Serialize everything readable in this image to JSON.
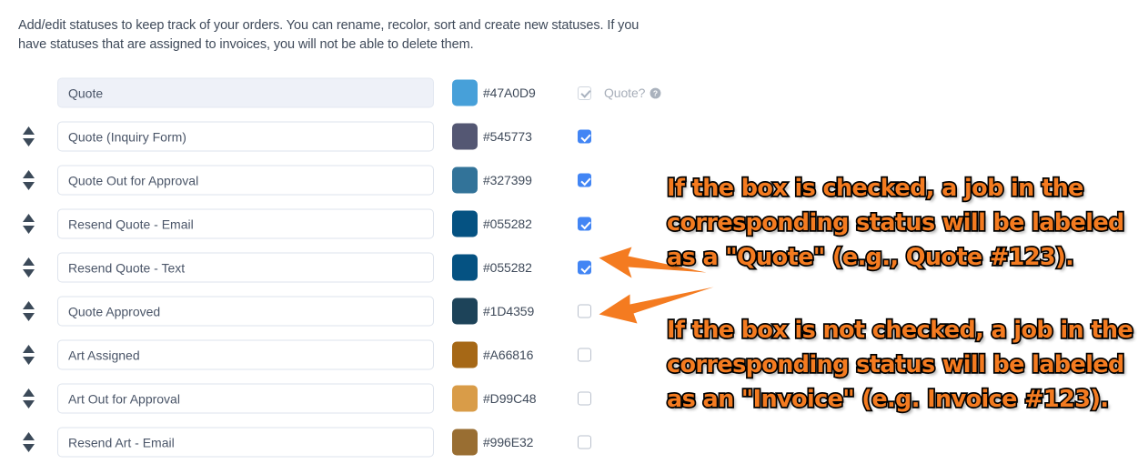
{
  "intro": {
    "text": "Add/edit statuses to keep track of your orders. You can rename, recolor, sort and create new statuses. If you have statuses that are assigned to invoices, you will not be able to delete them."
  },
  "quote_column": {
    "label": "Quote?",
    "help_icon": "help-circle-icon"
  },
  "icons": {
    "sort": "sort-updown-icon",
    "swatch": "color-swatch-icon",
    "arrow": "arrow-left-icon"
  },
  "colors": {
    "checkbox_checked": "#4285f4",
    "annotation": "#F47B20",
    "annotation_outline": "#000000",
    "arrow": "#F47B20"
  },
  "rows": [
    {
      "name": "Quote",
      "hex": "#47A0D9",
      "checked": true,
      "disabled": true,
      "sortable": false,
      "show_quote_label": true
    },
    {
      "name": "Quote (Inquiry Form)",
      "hex": "#545773",
      "checked": true,
      "disabled": false,
      "sortable": true,
      "show_quote_label": false
    },
    {
      "name": "Quote Out for Approval",
      "hex": "#327399",
      "checked": true,
      "disabled": false,
      "sortable": true,
      "show_quote_label": false
    },
    {
      "name": "Resend Quote - Email",
      "hex": "#055282",
      "checked": true,
      "disabled": false,
      "sortable": true,
      "show_quote_label": false
    },
    {
      "name": "Resend Quote - Text",
      "hex": "#055282",
      "checked": true,
      "disabled": false,
      "sortable": true,
      "show_quote_label": false
    },
    {
      "name": "Quote Approved",
      "hex": "#1D4359",
      "checked": false,
      "disabled": false,
      "sortable": true,
      "show_quote_label": false
    },
    {
      "name": "Art Assigned",
      "hex": "#A66816",
      "checked": false,
      "disabled": false,
      "sortable": true,
      "show_quote_label": false
    },
    {
      "name": "Art Out for Approval",
      "hex": "#D99C48",
      "checked": false,
      "disabled": false,
      "sortable": true,
      "show_quote_label": false
    },
    {
      "name": "Resend Art - Email",
      "hex": "#996E32",
      "checked": false,
      "disabled": false,
      "sortable": true,
      "show_quote_label": false
    }
  ],
  "annotations": {
    "checked": "If the box is checked, a job in the\ncorresponding status will be labeled\nas a \"Quote\" (e.g., Quote #123).",
    "unchecked": "If the box is not checked, a job in the\ncorresponding status will be labeled\nas an \"Invoice\" (e.g. Invoice #123)."
  }
}
